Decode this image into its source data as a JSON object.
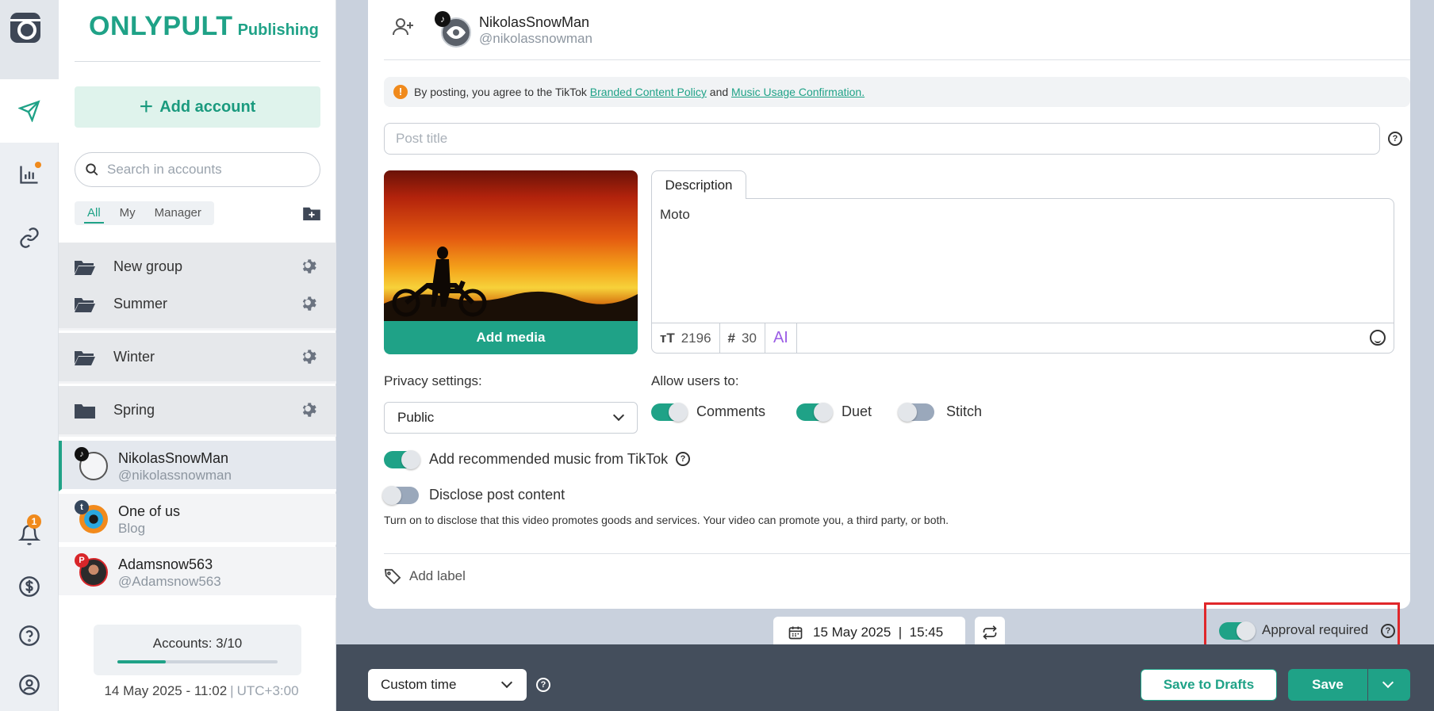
{
  "brand": {
    "name": "ONLYPULT",
    "product": "Publishing"
  },
  "notifications": {
    "count": "1"
  },
  "panel": {
    "add_account_label": "Add account",
    "search_placeholder": "Search in accounts",
    "filters": [
      "All",
      "My",
      "Manager"
    ],
    "active_filter": "All",
    "groups": [
      "New group",
      "Summer",
      "Winter",
      "Spring"
    ],
    "accounts": [
      {
        "name": "NikolasSnowMan",
        "handle": "@nikolassnowman",
        "network": "tiktok",
        "active": true
      },
      {
        "name": "One of us",
        "handle": "Blog",
        "network": "tumblr",
        "active": false
      },
      {
        "name": "Adamsnow563",
        "handle": "@Adamsnow563",
        "network": "pinterest",
        "active": false
      }
    ],
    "accounts_count": "Accounts: 3/10",
    "accounts_used_fraction": 0.3,
    "date_time": "14 May 2025 - 11:02",
    "timezone": "UTC+3:00"
  },
  "post": {
    "account_name": "NikolasSnowMan",
    "account_handle": "@nikolassnowman",
    "notice": {
      "prefix": "By posting, you agree to the TikTok",
      "link1": "Branded Content Policy",
      "middle": "and",
      "link2": "Music Usage Confirmation."
    },
    "title_placeholder": "Post title",
    "add_media_label": "Add media",
    "description_tab": "Description",
    "description_text": "Moto",
    "chars_left": "2196",
    "hashtags_left": "30",
    "ai_label": "AI",
    "privacy_label": "Privacy settings:",
    "privacy_value": "Public",
    "allow_label": "Allow users to:",
    "allow": [
      {
        "label": "Comments",
        "on": true
      },
      {
        "label": "Duet",
        "on": true
      },
      {
        "label": "Stitch",
        "on": false
      }
    ],
    "music_label": "Add recommended music from TikTok",
    "music_on": true,
    "disclose_label": "Disclose post content",
    "disclose_on": false,
    "disclose_note": "Turn on to disclose that this video promotes goods and services. Your video can promote you, a third party, or both.",
    "add_label": "Add label"
  },
  "schedule": {
    "date": "15 May 2025",
    "time": "15:45",
    "approval_label": "Approval required",
    "approval_on": true
  },
  "footer": {
    "time_mode": "Custom time",
    "save_drafts_label": "Save to Drafts",
    "save_label": "Save"
  },
  "colors": {
    "accent": "#1fa287",
    "warning": "#f08a1c",
    "highlight": "#e0272b",
    "footer": "#444e5c"
  }
}
